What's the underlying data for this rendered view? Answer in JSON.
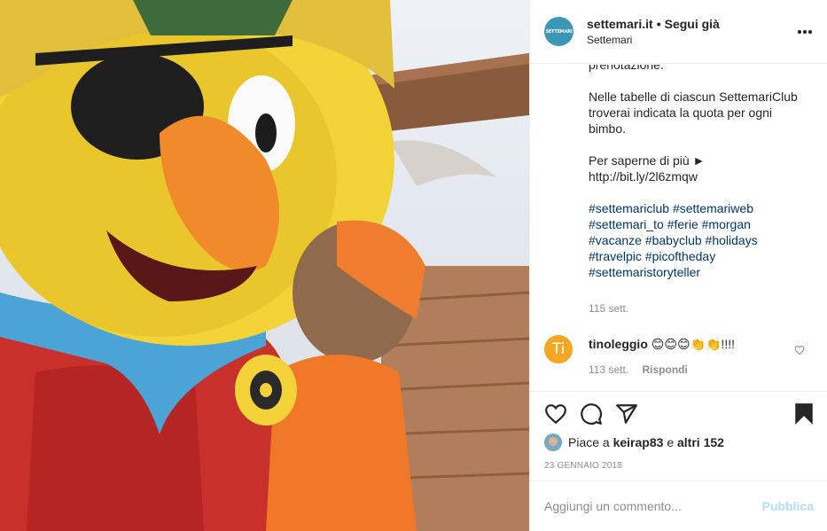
{
  "post": {
    "photo_description": "",
    "header": {
      "avatar_text": "SETTEMARI",
      "username": "settemari.it",
      "separator": "•",
      "follow_label": "Segui già",
      "subtitle": "Settemari"
    },
    "caption": {
      "cut_line": "prenotazione.",
      "paragraph_1": "Nelle tabelle di ciascun SettemariClub troverai indicata la quota per ogni bimbo.",
      "paragraph_2_line_1": "Per saperne di più ►",
      "paragraph_2_line_2": "http://bit.ly/2l6zmqw",
      "hashtags": [
        "#settemariclub",
        "#settemariweb",
        "#settemari_to",
        "#ferie",
        "#morgan",
        "#vacanze",
        "#babyclub",
        "#holidays",
        "#travelpic",
        "#picoftheday",
        "#settemaristoryteller"
      ],
      "time": "115 sett."
    },
    "comments": [
      {
        "avatar_text": "Ti",
        "username": "tinoleggio",
        "text": "😊😊😊👏👏!!!!",
        "time": "113 sett.",
        "reply_label": "Rispondi"
      }
    ],
    "likes": {
      "prefix": "Piace a",
      "user": "keirap83",
      "connector": "e",
      "others": "altri 152"
    },
    "date": "23 GENNAIO 2018",
    "add_comment": {
      "placeholder": "Aggiungi un commento...",
      "publish_label": "Pubblica"
    },
    "colors": {
      "link": "#00376b",
      "publish_disabled": "#b2dffc",
      "secondary_text": "#8e8e8e",
      "brand_avatar": "#3a97b5",
      "comment_avatar": "#f5a623"
    },
    "icons": [
      "more-options-icon",
      "heart-icon",
      "comment-icon",
      "share-icon",
      "bookmark-icon",
      "comment-like-icon"
    ]
  }
}
